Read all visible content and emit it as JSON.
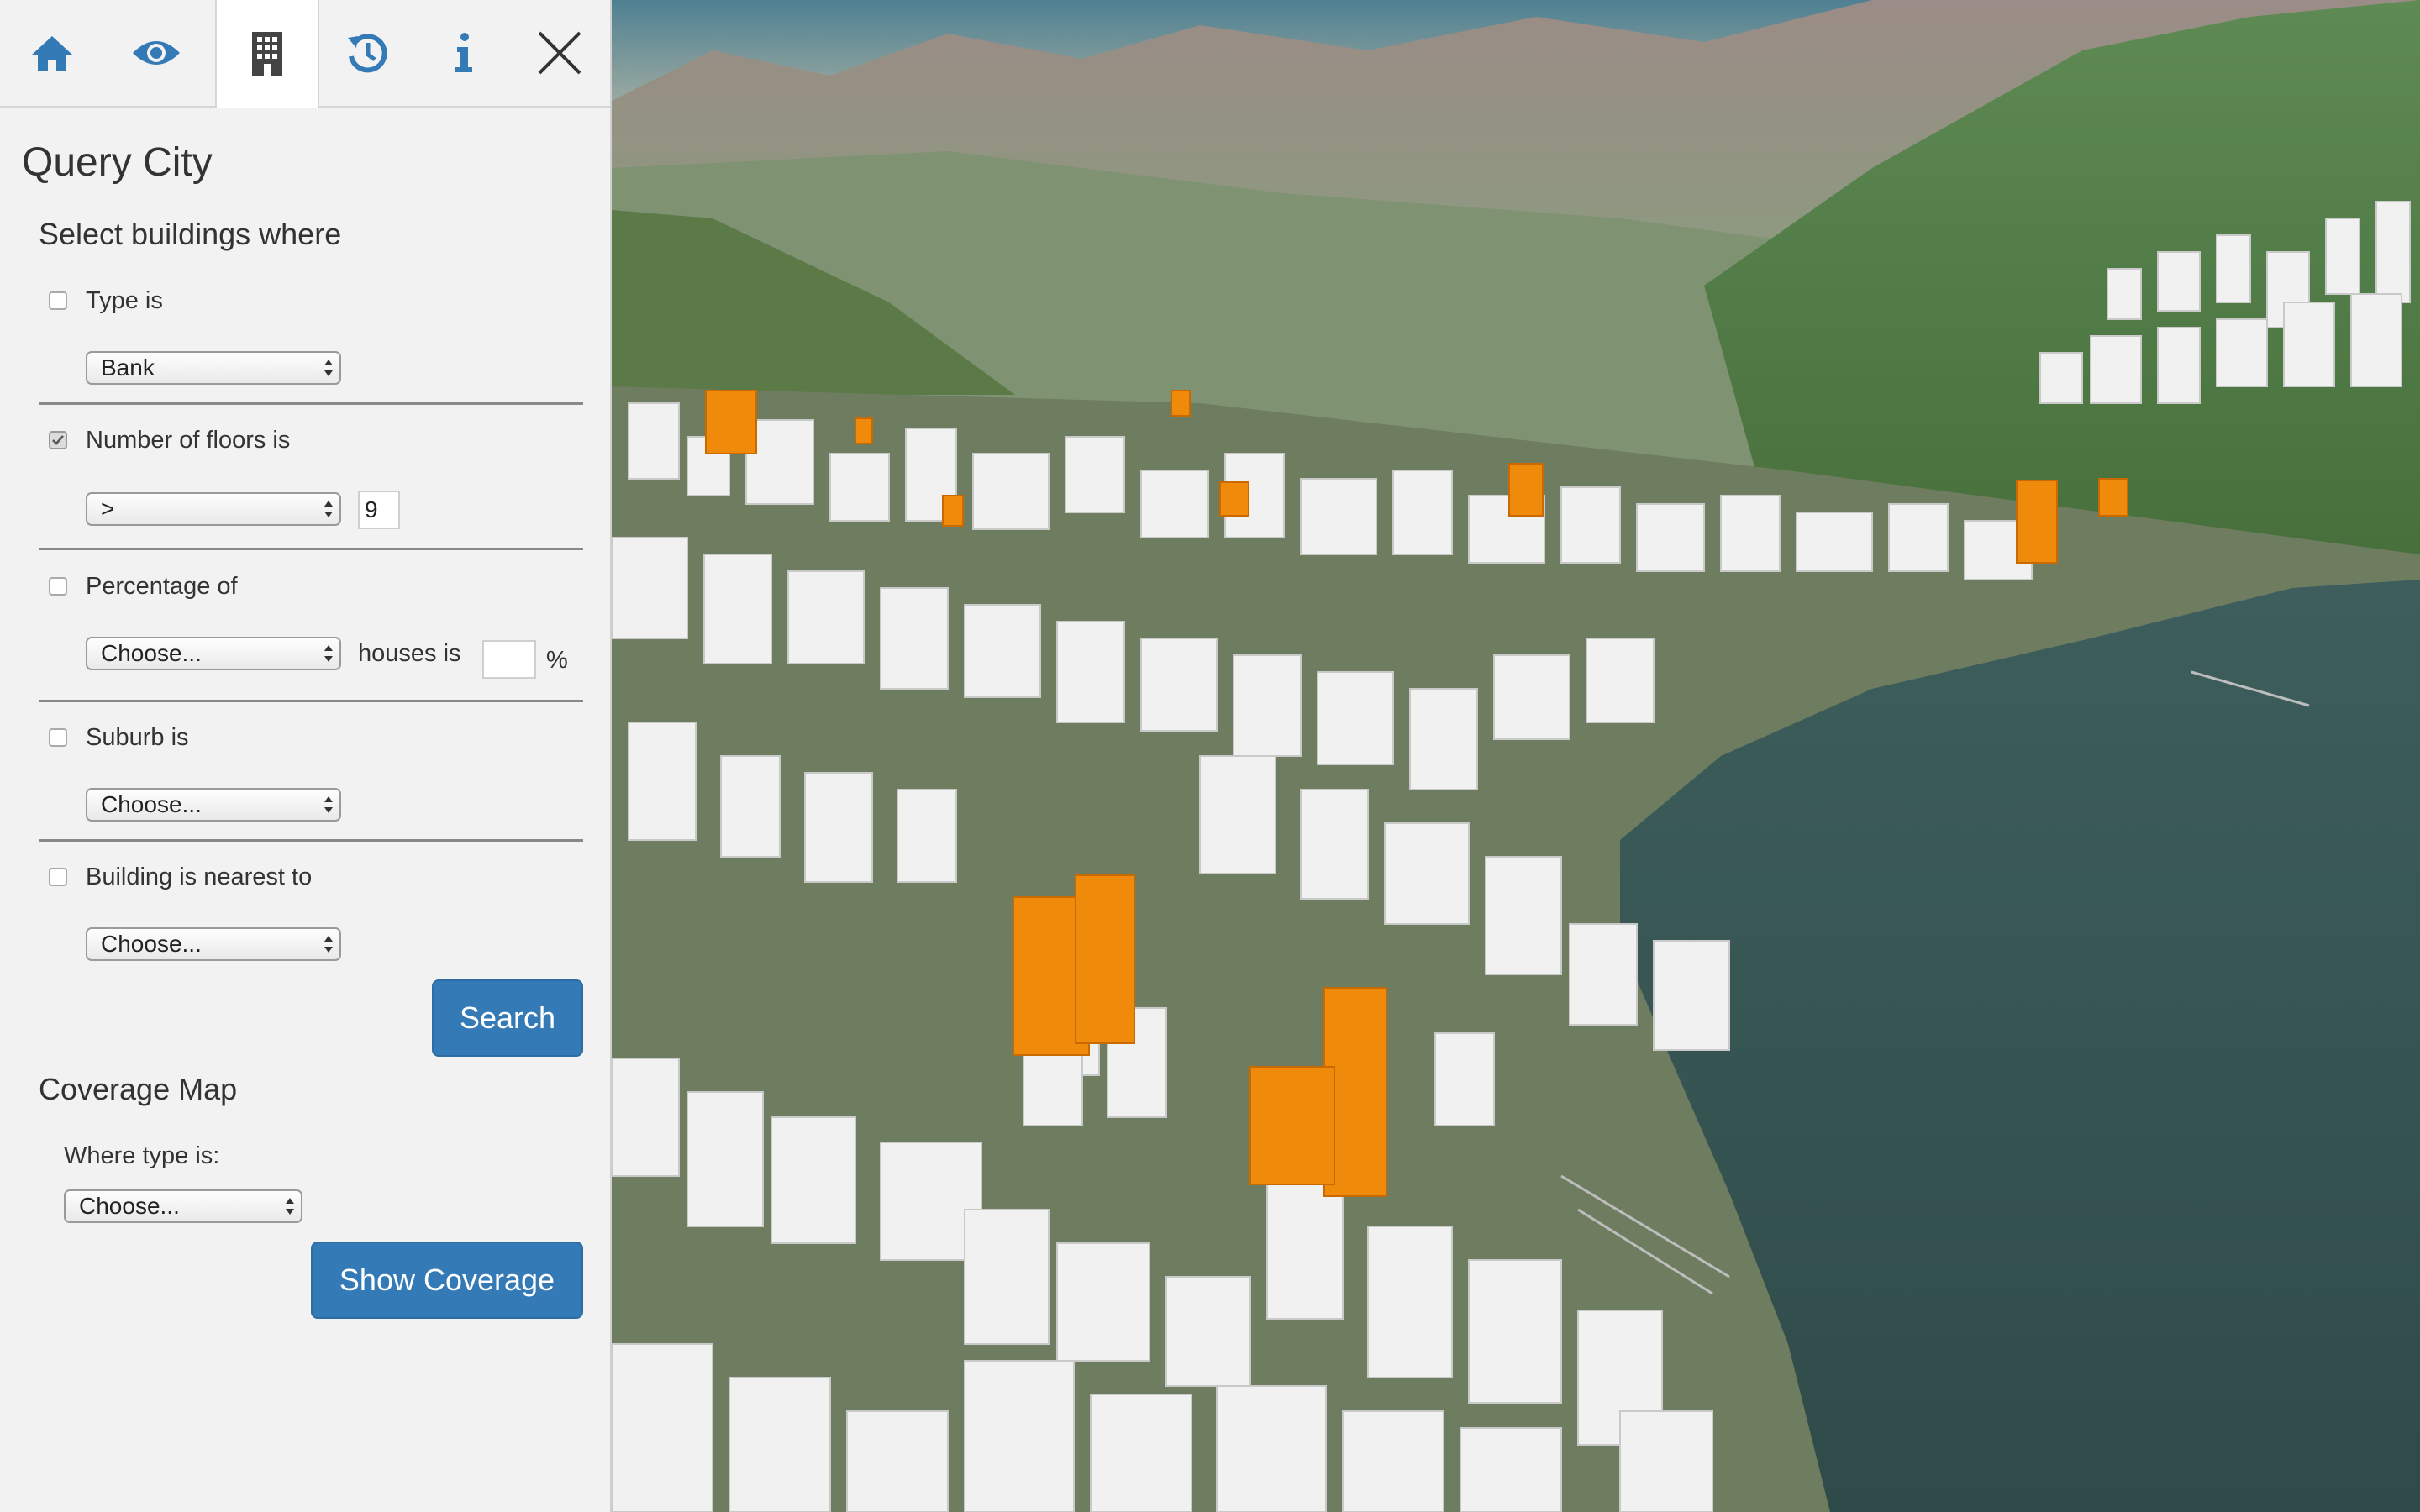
{
  "panel": {
    "title": "Query City",
    "tabs": [
      {
        "icon": "home-icon"
      },
      {
        "icon": "eye-icon"
      },
      {
        "icon": "building-icon",
        "active": true
      },
      {
        "icon": "history-icon"
      },
      {
        "icon": "info-icon"
      },
      {
        "icon": "close-icon"
      }
    ],
    "select_heading": "Select buildings where",
    "filters": {
      "type": {
        "label": "Type is",
        "checked": false,
        "value": "Bank"
      },
      "floors": {
        "label": "Number of floors is",
        "checked": true,
        "operator": ">",
        "value": "9"
      },
      "percentage": {
        "label": "Percentage of",
        "checked": false,
        "value": "Choose...",
        "suffix": "houses is",
        "amount": "",
        "unit": "%"
      },
      "suburb": {
        "label": "Suburb is",
        "checked": false,
        "value": "Choose..."
      },
      "nearest": {
        "label": "Building is nearest to",
        "checked": false,
        "value": "Choose..."
      }
    },
    "search_label": "Search",
    "coverage_heading": "Coverage Map",
    "coverage_where_label": "Where type is:",
    "coverage_value": "Choose...",
    "show_coverage_label": "Show Coverage"
  },
  "map": {
    "help_glyph": "?",
    "highlight_color": "#f08a0a",
    "accent_color": "#337ab7"
  }
}
